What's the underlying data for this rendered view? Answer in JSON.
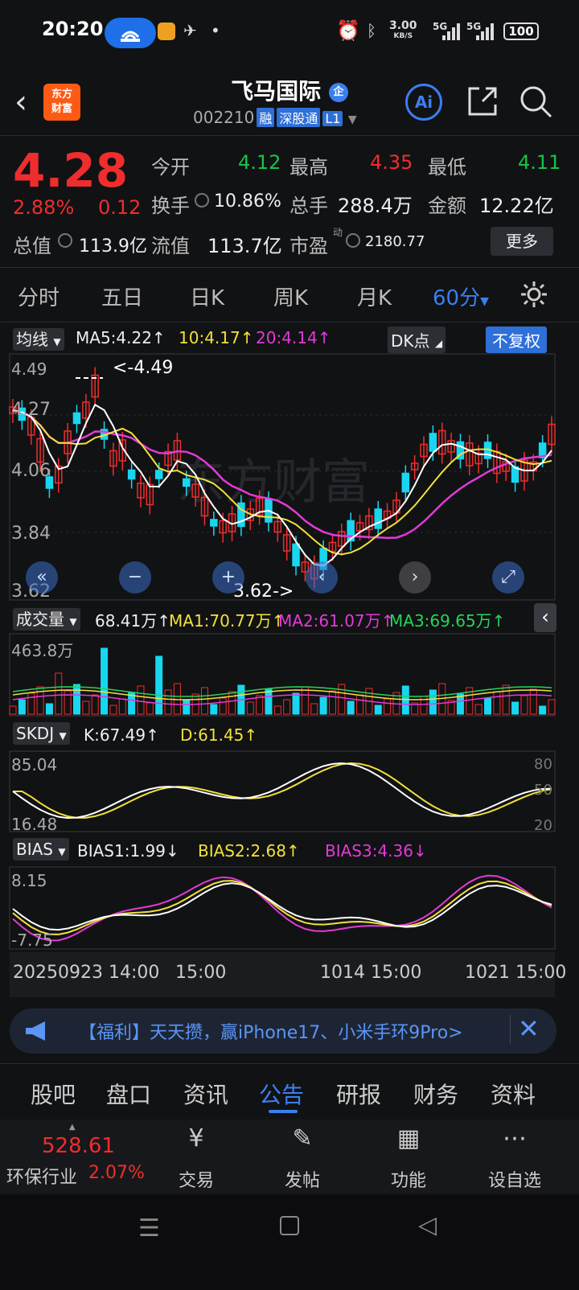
{
  "status": {
    "time": "20:20",
    "net_speed": "3.00",
    "net_unit": "KB/S",
    "sig1": "5G",
    "sig2": "5G",
    "battery": "100"
  },
  "header": {
    "logo_line1": "东方",
    "logo_line2": "财富",
    "stock_name": "飞马国际",
    "badge": "企",
    "code": "002210",
    "tags": [
      "融",
      "深股通",
      "L1"
    ],
    "ai_label": "Ai"
  },
  "quote": {
    "price": "4.28",
    "change_pct": "2.88%",
    "change_amt": "0.12",
    "open_label": "今开",
    "open": "4.12",
    "high_label": "最高",
    "high": "4.35",
    "low_label": "最低",
    "low": "4.11",
    "turnover_label": "换手",
    "turnover": "10.86%",
    "volume_label": "总手",
    "volume": "288.4万",
    "amount_label": "金额",
    "amount": "12.22亿",
    "mktcap_label": "总值",
    "mktcap": "113.9亿",
    "float_label": "流值",
    "float": "113.7亿",
    "pe_label": "市盈",
    "pe_sup": "动",
    "pe": "2180.77",
    "more_label": "更多"
  },
  "period_tabs": [
    "分时",
    "五日",
    "日K",
    "周K",
    "月K",
    "60分"
  ],
  "main_chart": {
    "ind_label": "均线",
    "ma5": "MA5:4.22↑",
    "ma10": "10:4.17↑",
    "ma20": "20:4.14↑",
    "dk_label": "DK点",
    "adj_label": "不复权",
    "y_ticks": [
      "4.49",
      "4.27",
      "4.06",
      "3.84",
      "3.62"
    ],
    "high_marker": "<-4.49",
    "low_marker": "3.62->",
    "watermark": "东方财富"
  },
  "volume_panel": {
    "ind_label": "成交量",
    "vol": "68.41万↑",
    "ma1": "MA1:70.77万↑",
    "ma2": "MA2:61.07万↑",
    "ma3": "MA3:69.65万↑",
    "y_top": "463.8万"
  },
  "skdj_panel": {
    "ind_label": "SKDJ",
    "k": "K:67.49↑",
    "d": "D:61.45↑",
    "y_top": "85.04",
    "y_bottom": "16.48",
    "r_ticks": [
      "80",
      "50",
      "20"
    ]
  },
  "bias_panel": {
    "ind_label": "BIAS",
    "bias1": "BIAS1:1.99↓",
    "bias2": "BIAS2:2.68↑",
    "bias3": "BIAS3:4.36↓",
    "y_top": "8.15",
    "y_bottom": "-7.75"
  },
  "x_axis": [
    "20250923 14:00",
    "15:00",
    "1014 15:00",
    "1021 15:00"
  ],
  "banner": {
    "text": "【福利】天天攒，赢iPhone17、小米手环9Pro>"
  },
  "info_tabs": [
    "股吧",
    "盘口",
    "资讯",
    "公告",
    "研报",
    "财务",
    "资料"
  ],
  "bottom_bar": {
    "index_value": "528.61",
    "index_name": "环保行业",
    "index_change": "2.07%",
    "actions": [
      "交易",
      "发帖",
      "功能",
      "设自选"
    ]
  },
  "colors": {
    "up": "#f02d2d",
    "down": "#16c24a",
    "candle_down": "#19d6f0",
    "accent": "#3a7ff0",
    "ma5": "#ffffff",
    "ma10": "#f1e13b",
    "ma20": "#e23ad8"
  }
}
